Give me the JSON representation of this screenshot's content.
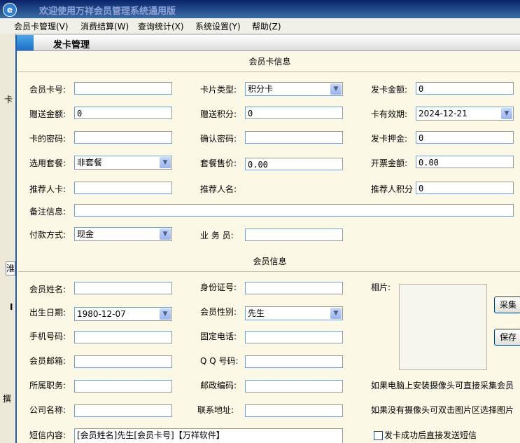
{
  "app": {
    "title": "欢迎使用万祥会员管理系统通用版",
    "icon_glyph": "e"
  },
  "menu": [
    {
      "label": "会员卡管理(V)"
    },
    {
      "label": "消费结算(W)"
    },
    {
      "label": "查询统计(X)"
    },
    {
      "label": "系统设置(Y)"
    },
    {
      "label": "帮助(Z)"
    }
  ],
  "background_fragments": [
    "卡",
    "",
    "淮",
    "Ⅰ",
    "撰"
  ],
  "dialog": {
    "title": "发卡管理",
    "card_section": {
      "header": "会员卡信息",
      "card_no": {
        "label": "会员卡号:",
        "value": ""
      },
      "card_type": {
        "label": "卡片类型:",
        "value": "积分卡"
      },
      "issue_amount": {
        "label": "发卡金额:",
        "value": "0"
      },
      "gift_amount": {
        "label": "赠送金额:",
        "value": "0"
      },
      "gift_points": {
        "label": "赠送积分:",
        "value": "0"
      },
      "expiry": {
        "label": "卡有效期:",
        "value": "2024-12-21"
      },
      "password": {
        "label": "卡的密码:",
        "value": ""
      },
      "confirm_password": {
        "label": "确认密码:",
        "value": ""
      },
      "deposit": {
        "label": "发卡押金:",
        "value": "0"
      },
      "package": {
        "label": "选用套餐:",
        "value": "非套餐"
      },
      "package_price": {
        "label": "套餐售价:",
        "value": "0.00"
      },
      "invoice_amount": {
        "label": "开票金额:",
        "value": "0.00"
      },
      "referrer_card": {
        "label": "推荐人卡:",
        "value": ""
      },
      "referrer_name": {
        "label": "推荐人名:",
        "value": ""
      },
      "referrer_points": {
        "label": "推荐人积分",
        "value": "0"
      },
      "remark": {
        "label": "备注信息:",
        "value": ""
      },
      "payment": {
        "label": "付款方式:",
        "value": "现金"
      },
      "salesperson": {
        "label": "业 务 员:",
        "value": ""
      }
    },
    "member_section": {
      "header": "会员信息",
      "name": {
        "label": "会员姓名:",
        "value": ""
      },
      "id_no": {
        "label": "身份证号:",
        "value": ""
      },
      "photo": {
        "label": "相片:"
      },
      "birthday": {
        "label": "出生日期:",
        "value": "1980-12-07"
      },
      "gender": {
        "label": "会员性别:",
        "value": "先生"
      },
      "mobile": {
        "label": "手机号码:",
        "value": ""
      },
      "phone": {
        "label": "固定电话:",
        "value": ""
      },
      "email": {
        "label": "会员邮箱:",
        "value": ""
      },
      "qq": {
        "label": "Q Q 号码:",
        "value": ""
      },
      "job": {
        "label": "所属职务:",
        "value": ""
      },
      "postcode": {
        "label": "邮政编码:",
        "value": ""
      },
      "company": {
        "label": "公司名称:",
        "value": ""
      },
      "address": {
        "label": "联系地址:",
        "value": ""
      },
      "sms": {
        "label": "短信内容:",
        "value": "[会员姓名]先生[会员卡号]【万祥软件】"
      },
      "capture_button": "采集",
      "save_button": "保存",
      "hint_camera": "如果电脑上安装摄像头可直接采集会员",
      "hint_no_camera": "如果没有摄像头可双击图片区选择图片",
      "send_sms_checkbox": {
        "label": "发卡成功后直接发送短信",
        "checked": false
      }
    }
  }
}
